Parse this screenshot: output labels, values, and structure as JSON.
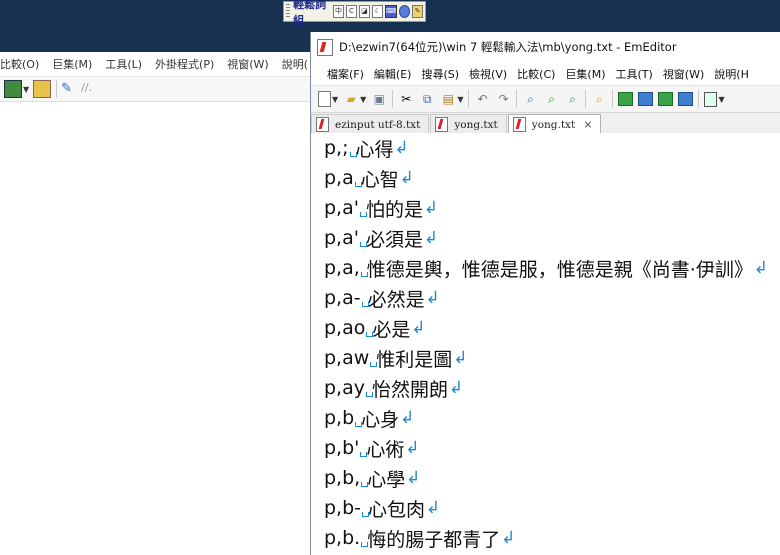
{
  "ime_toolbar": {
    "name": "輕鬆詞組",
    "icons": [
      "mode-icon",
      "c-icon",
      "d-icon",
      "moon-icon",
      "keyboard-icon",
      "gear-icon",
      "pen-icon"
    ]
  },
  "background_window": {
    "menu": [
      "比較(O)",
      "巨集(M)",
      "工具(L)",
      "外掛程式(P)",
      "視窗(W)",
      "說明("
    ]
  },
  "window": {
    "title": "D:\\ezwin7(64位元)\\win 7  輕鬆輸入法\\mb\\yong.txt - EmEditor",
    "menu": [
      "檔案(F)",
      "編輯(E)",
      "搜尋(S)",
      "檢視(V)",
      "比較(C)",
      "巨集(M)",
      "工具(T)",
      "視窗(W)",
      "說明(H"
    ],
    "tabs": [
      {
        "label": "ezinput utf-8.txt",
        "active": false
      },
      {
        "label": "yong.txt",
        "active": false
      },
      {
        "label": "yong.txt",
        "active": true
      }
    ],
    "close_glyph": "×"
  },
  "editor_lines": [
    {
      "code": "p,;",
      "text": "心得"
    },
    {
      "code": "p,a",
      "text": "心智"
    },
    {
      "code": "p,a'",
      "text": "怕的是"
    },
    {
      "code": "p,a'",
      "text": "必須是"
    },
    {
      "code": "p,a,",
      "text": "惟德是輿，惟德是服，惟德是親《尚書·伊訓》"
    },
    {
      "code": "p,a-",
      "text": "必然是"
    },
    {
      "code": "p,ao",
      "text": "必是"
    },
    {
      "code": "p,aw",
      "text": "惟利是圖"
    },
    {
      "code": "p,ay",
      "text": "怡然開朗"
    },
    {
      "code": "p,b",
      "text": "心身"
    },
    {
      "code": "p,b'",
      "text": "心術"
    },
    {
      "code": "p,b,",
      "text": "心學"
    },
    {
      "code": "p,b-",
      "text": "心包肉"
    },
    {
      "code": "p,b.",
      "text": "悔的腸子都青了"
    }
  ],
  "colors": {
    "desktop": "#19324f",
    "whitespace_mark": "#1e8ad6"
  }
}
